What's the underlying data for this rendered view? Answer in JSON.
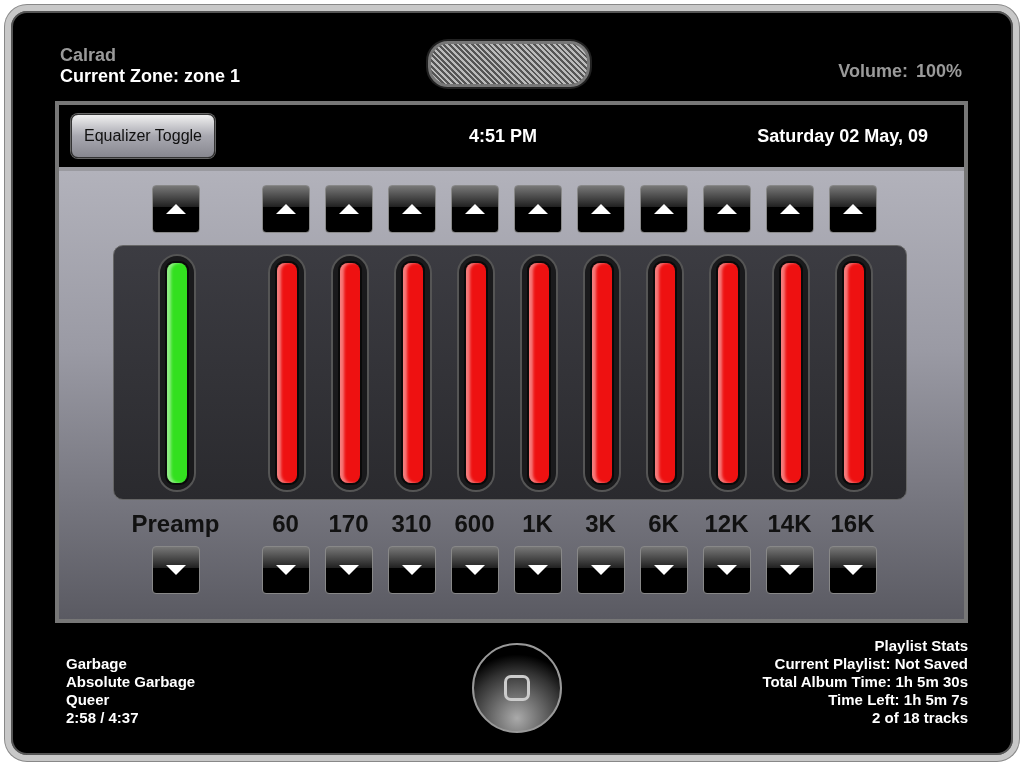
{
  "device": {
    "brand": "Calrad",
    "zone": "Current Zone: zone 1",
    "volume_label": "Volume:",
    "volume_value": "100%"
  },
  "toolbar": {
    "toggle_button": "Equalizer Toggle",
    "time": "4:51 PM",
    "date": "Saturday 02 May, 09"
  },
  "bands": [
    {
      "label": "Preamp",
      "kind": "preamp",
      "color": "#33e01f",
      "level": 1
    },
    {
      "label": "60",
      "kind": "band",
      "color": "#ee1111",
      "level": 1
    },
    {
      "label": "170",
      "kind": "band",
      "color": "#ee1111",
      "level": 1
    },
    {
      "label": "310",
      "kind": "band",
      "color": "#ee1111",
      "level": 1
    },
    {
      "label": "600",
      "kind": "band",
      "color": "#ee1111",
      "level": 1
    },
    {
      "label": "1K",
      "kind": "band",
      "color": "#ee1111",
      "level": 1
    },
    {
      "label": "3K",
      "kind": "band",
      "color": "#ee1111",
      "level": 1
    },
    {
      "label": "6K",
      "kind": "band",
      "color": "#ee1111",
      "level": 1
    },
    {
      "label": "12K",
      "kind": "band",
      "color": "#ee1111",
      "level": 1
    },
    {
      "label": "14K",
      "kind": "band",
      "color": "#ee1111",
      "level": 1
    },
    {
      "label": "16K",
      "kind": "band",
      "color": "#ee1111",
      "level": 1
    }
  ],
  "now_playing": {
    "artist": "Garbage",
    "album": "Absolute Garbage",
    "track": "Queer",
    "position": "2:58 / 4:37"
  },
  "playlist_stats": {
    "title": "Playlist Stats",
    "lines": [
      "Current Playlist: Not Saved",
      "Total Album Time: 1h 5m 30s",
      "Time Left: 1h 5m 7s",
      "2 of 18 tracks"
    ]
  }
}
